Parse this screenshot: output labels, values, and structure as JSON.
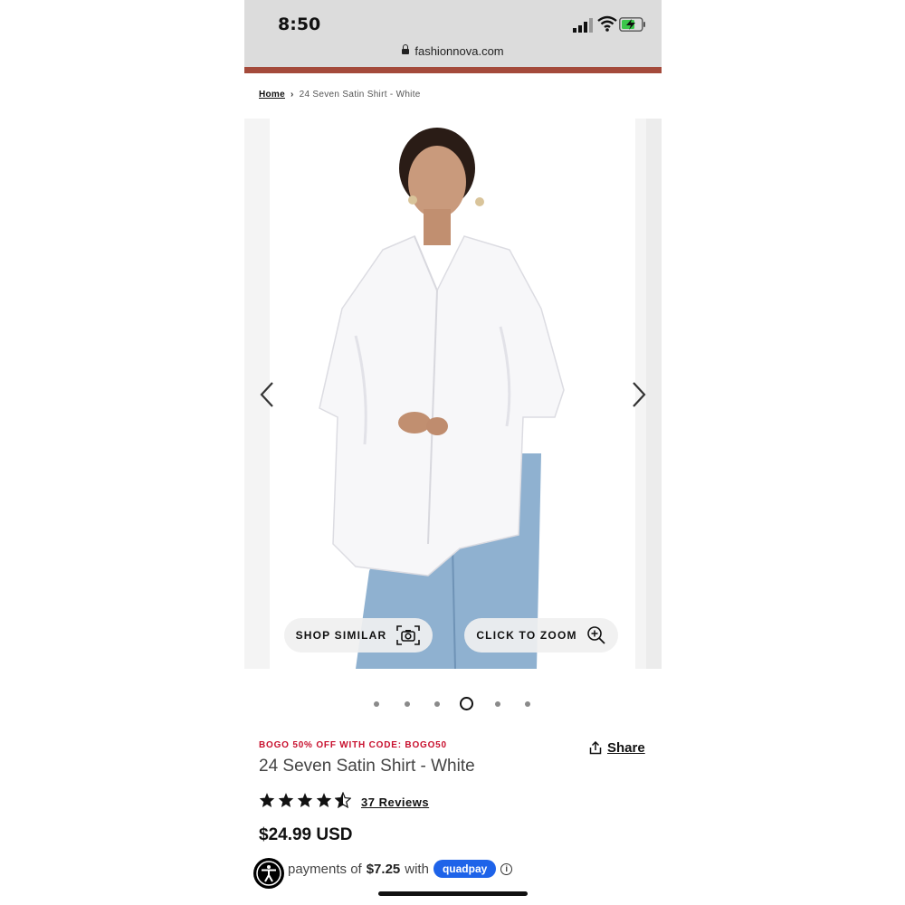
{
  "status_bar": {
    "time": "8:50",
    "url": "fashionnova.com"
  },
  "breadcrumb": {
    "home": "Home",
    "current": "24 Seven Satin Shirt - White"
  },
  "gallery": {
    "shop_similar_label": "SHOP SIMILAR",
    "zoom_label": "CLICK TO ZOOM",
    "slide_count": 6,
    "active_slide": 4
  },
  "product": {
    "promo": "BOGO 50% OFF WITH CODE: BOGO50",
    "title": "24 Seven Satin Shirt - White",
    "share_label": "Share",
    "rating": 4.5,
    "rating_max": 5,
    "reviews_label": "37 Reviews",
    "price": "$24.99 USD",
    "payment_prefix": "payments of",
    "payment_amount": "$7.25",
    "payment_with": "with",
    "payment_provider": "quadpay"
  },
  "colors": {
    "promo_red": "#c8102e",
    "quadpay_blue": "#1e63e9",
    "header_bar": "#a44a3b"
  }
}
